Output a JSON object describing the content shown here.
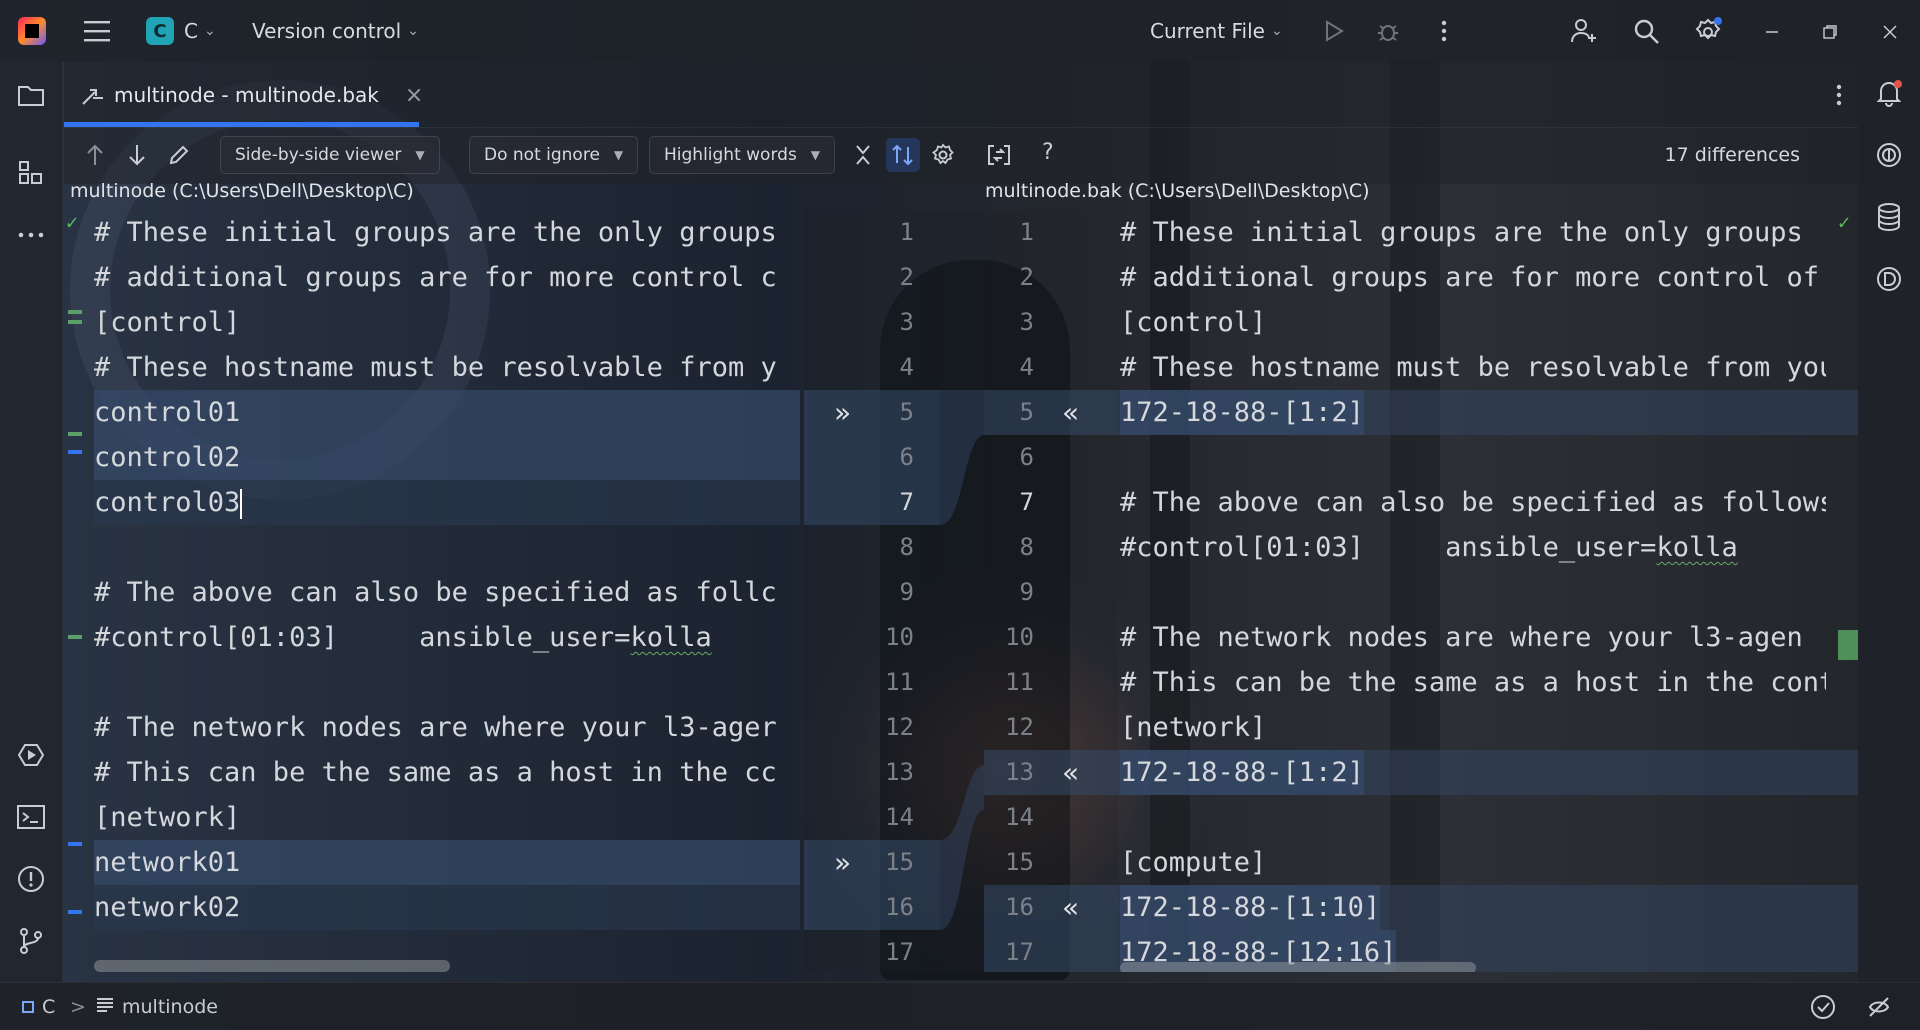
{
  "titlebar": {
    "project_letter": "C",
    "project_name": "C",
    "vcs_label": "Version control",
    "run_config": "Current File"
  },
  "tab": {
    "label": "multinode - multinode.bak",
    "close_glyph": "×"
  },
  "toolbar": {
    "viewer": "Side-by-side viewer",
    "ignore": "Do not ignore",
    "highlight": "Highlight words",
    "help": "?",
    "differences": "17 differences"
  },
  "left": {
    "path": "multinode (C:\\Users\\Dell\\Desktop\\C)",
    "lines": [
      "# These initial groups are the only groups",
      "# additional groups are for more control c",
      "[control]",
      "# These hostname must be resolvable from y",
      "control01",
      "control02",
      "control03",
      "",
      "# The above can also be specified as follc",
      "#control[01:03]     ansible_user=",
      "",
      "# The network nodes are where your l3-ager",
      "# This can be the same as a host in the cc",
      "[network]",
      "network01",
      "network02",
      ""
    ],
    "squiggle_word": "kolla",
    "line_numbers": [
      "1",
      "2",
      "3",
      "4",
      "5",
      "6",
      "7",
      "8",
      "9",
      "10",
      "11",
      "12",
      "13",
      "14",
      "15",
      "16",
      "17"
    ]
  },
  "right": {
    "path": "multinode.bak (C:\\Users\\Dell\\Desktop\\C)",
    "lines": [
      "# These initial groups are the only groups",
      "# additional groups are for more control of",
      "[control]",
      "# These hostname must be resolvable from you",
      "172-18-88-[1:2]",
      "",
      "# The above can also be specified as follows",
      "#control[01:03]     ansible_user=",
      "",
      "# The network nodes are where your l3-agen",
      "# This can be the same as a host in the cont",
      "[network]",
      "172-18-88-[1:2]",
      "",
      "[compute]",
      "172-18-88-[1:10]",
      "172-18-88-[12:16]"
    ],
    "squiggle_word": "kolla",
    "line_numbers": [
      "1",
      "2",
      "3",
      "4",
      "5",
      "6",
      "7",
      "8",
      "9",
      "10",
      "11",
      "12",
      "13",
      "14",
      "15",
      "16",
      "17"
    ]
  },
  "diff_arrows": {
    "push_right": "»",
    "pull_left": "«"
  },
  "statusbar": {
    "project": "C",
    "separator": ">",
    "file": "multinode"
  },
  "colors": {
    "accent": "#3574f0",
    "added_marker": "#5b9f6a",
    "changed_block": "#354a68"
  }
}
